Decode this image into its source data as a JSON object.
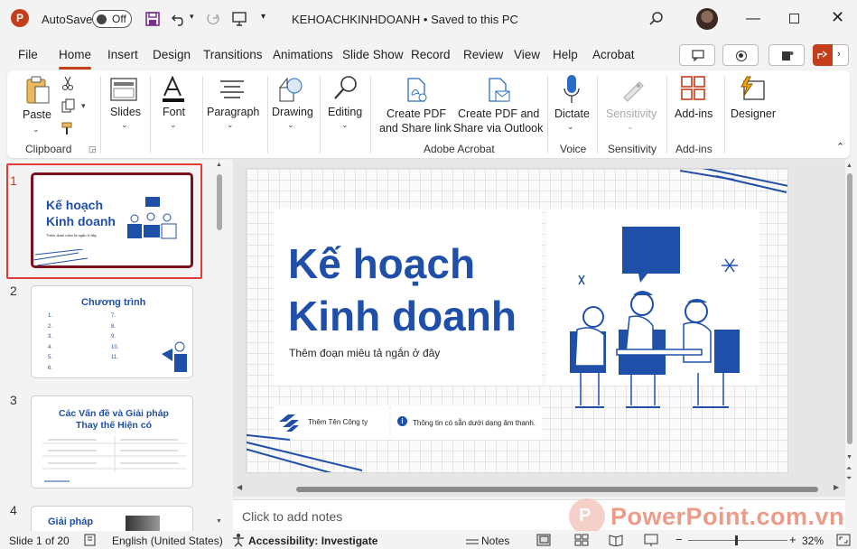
{
  "titlebar": {
    "autosave_label": "AutoSave",
    "autosave_state": "Off",
    "doc_title": "KEHOACHKINHDOANH • Saved to this PC"
  },
  "menu": {
    "tabs": [
      "File",
      "Home",
      "Insert",
      "Design",
      "Transitions",
      "Animations",
      "Slide Show",
      "Record",
      "Review",
      "View",
      "Help",
      "Acrobat"
    ],
    "active": "Home"
  },
  "ribbon": {
    "paste": "Paste",
    "clipboard_group": "Clipboard",
    "slides": "Slides",
    "font": "Font",
    "paragraph": "Paragraph",
    "drawing": "Drawing",
    "editing": "Editing",
    "create_pdf_line1": "Create PDF",
    "create_pdf_line2": "and Share link",
    "create_pdf_outlook_line1": "Create PDF and",
    "create_pdf_outlook_line2": "Share via Outlook",
    "acrobat_group": "Adobe Acrobat",
    "dictate": "Dictate",
    "voice_group": "Voice",
    "sensitivity": "Sensitivity",
    "sensitivity_group": "Sensitivity",
    "addins": "Add-ins",
    "addins_group": "Add-ins",
    "designer": "Designer"
  },
  "thumbnails": {
    "n1": "1",
    "n2": "2",
    "n3": "3",
    "n4": "4",
    "t1_title1": "Kế hoạch",
    "t1_title2": "Kinh doanh",
    "t1_sub": "Thêm đoạn miêu tả ngắn ở đây",
    "t2_title": "Chương trình",
    "t2_left": [
      "1.",
      "2.",
      "3.",
      "4.",
      "5.",
      "6."
    ],
    "t2_right": [
      "7.",
      "8.",
      "9.",
      "10.",
      "11."
    ],
    "t3_title1": "Các Vấn đề và Giải pháp",
    "t3_title2": "Thay thế Hiện có",
    "t4_title": "Giải pháp"
  },
  "slide": {
    "title1": "Kế hoạch",
    "title2": "Kinh doanh",
    "subtitle": "Thêm đoạn miêu tả ngắn ở đây",
    "company": "Thêm Tên Công ty",
    "info": "Thông tin có sẵn dưới dạng âm thanh."
  },
  "notes": {
    "placeholder": "Click to add notes"
  },
  "watermark": "PowerPoint.com.vn",
  "status": {
    "slide_count": "Slide 1 of 20",
    "language": "English (United States)",
    "accessibility": "Accessibility: Investigate",
    "notes": "Notes",
    "zoom": "32%"
  },
  "colors": {
    "accent": "#c43e1c",
    "brand_blue": "#1f4fa8",
    "selection": "#e23b3b"
  }
}
